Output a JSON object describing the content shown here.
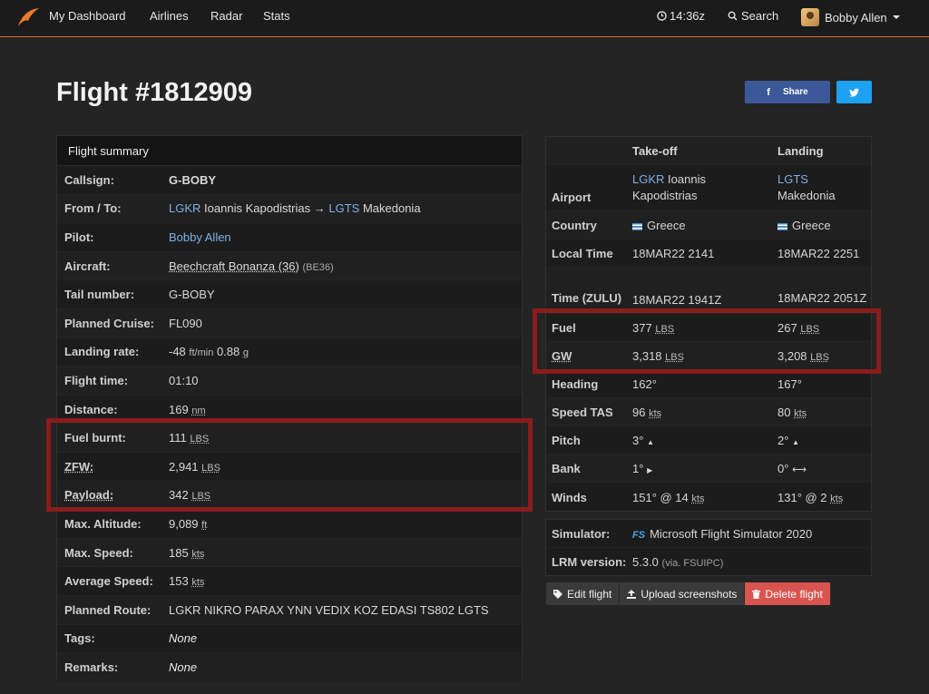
{
  "nav": {
    "links": [
      "My Dashboard",
      "Airlines",
      "Radar",
      "Stats"
    ],
    "time": "14:36z",
    "search": "Search",
    "user": "Bobby Allen"
  },
  "page": {
    "title": "Flight #1812909",
    "share_label": "Share"
  },
  "summary": {
    "heading": "Flight summary",
    "callsign_label": "Callsign:",
    "callsign": "G-BOBY",
    "route_label": "From / To:",
    "from_code": "LGKR",
    "from_name": "Ioannis Kapodistrias",
    "arrow": "→",
    "to_code": "LGTS",
    "to_name": "Makedonia",
    "pilot_label": "Pilot:",
    "pilot": "Bobby Allen",
    "aircraft_label": "Aircraft:",
    "aircraft": "Beechcraft Bonanza (36)",
    "aircraft_code": "(BE36)",
    "tail_label": "Tail number:",
    "tail": "G-BOBY",
    "cruise_label": "Planned Cruise:",
    "cruise": "FL090",
    "landing_label": "Landing rate:",
    "landing_rate": "-48",
    "landing_unit": "ft/min",
    "landing_g": "0.88",
    "landing_g_unit": "g",
    "flight_time_label": "Flight time:",
    "flight_time": "01:10",
    "distance_label": "Distance:",
    "distance": "169",
    "distance_unit": "nm",
    "fuel_burnt_label": "Fuel burnt:",
    "fuel_burnt": "111",
    "lbs": "LBS",
    "zfw_label": "ZFW:",
    "zfw": "2,941",
    "payload_label": "Payload:",
    "payload": "342",
    "max_alt_label": "Max. Altitude:",
    "max_alt": "9,089",
    "ft": "ft",
    "max_speed_label": "Max. Speed:",
    "max_speed": "185",
    "kts": "kts",
    "avg_speed_label": "Average Speed:",
    "avg_speed": "153",
    "route_plan_label": "Planned Route:",
    "route_plan": "LGKR NIKRO PARAX YNN VEDIX KOZ EDASI TS802 LGTS",
    "tags_label": "Tags:",
    "tags": "None",
    "remarks_label": "Remarks:",
    "remarks": "None"
  },
  "detail": {
    "takeoff_header": "Take-off",
    "landing_header": "Landing",
    "airport_label": "Airport",
    "to_code": "LGKR",
    "to_name": "Ioannis Kapodistrias",
    "ld_code": "LGTS",
    "ld_name": "Makedonia",
    "country_label": "Country",
    "to_country": "Greece",
    "ld_country": "Greece",
    "local_label": "Local Time",
    "to_local": "18MAR22 2141",
    "ld_local": "18MAR22 2251",
    "zulu_label": "Time (ZULU)",
    "to_zulu": "18MAR22 1941Z",
    "ld_zulu": "18MAR22 2051Z",
    "fuel_label": "Fuel",
    "to_fuel": "377",
    "ld_fuel": "267",
    "lbs": "LBS",
    "gw_label": "GW",
    "to_gw": "3,318",
    "ld_gw": "3,208",
    "heading_label": "Heading",
    "to_heading": "162°",
    "ld_heading": "167°",
    "tas_label": "Speed TAS",
    "to_tas": "96",
    "ld_tas": "80",
    "kts": "kts",
    "pitch_label": "Pitch",
    "to_pitch": "3°",
    "ld_pitch": "2°",
    "bank_label": "Bank",
    "to_bank": "1°",
    "ld_bank": "0°",
    "winds_label": "Winds",
    "to_winds": "151° @ 14",
    "ld_winds": "131° @ 2"
  },
  "sim": {
    "simulator_label": "Simulator:",
    "badge": "FS",
    "simulator": "Microsoft Flight Simulator 2020",
    "lrm_label": "LRM version:",
    "lrm": "5.3.0",
    "lrm_via": "(via. FSUIPC)"
  },
  "actions": {
    "edit": "Edit flight",
    "upload": "Upload screenshots",
    "delete": "Delete flight"
  },
  "colors": {
    "accent": "#e8662a",
    "highlight": "#8a1c1c",
    "facebook": "#3b5998",
    "twitter": "#1da1f2",
    "danger": "#d9534f",
    "link": "#7fb0e6"
  }
}
